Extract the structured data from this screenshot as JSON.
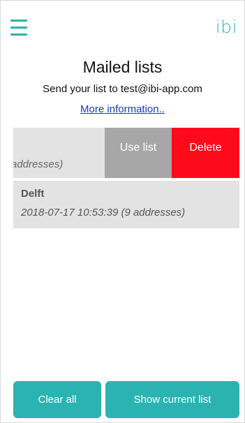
{
  "colors": {
    "accent": "#2bb3b1",
    "link": "#1b37c8",
    "use_list_bg": "#a7a7a7",
    "delete_bg": "#ff0a1a",
    "row_bg": "#e3e3e3"
  },
  "header": {
    "menu_icon": "hamburger-menu-icon",
    "logo_text": "ibi"
  },
  "main": {
    "title": "Mailed lists",
    "subtitle": "Send your list to test@ibi-app.com",
    "more_info_link": "More information.."
  },
  "lists": [
    {
      "visible_text": "addresses)",
      "actions": {
        "use_label": "Use list",
        "delete_label": "Delete"
      }
    },
    {
      "name": "Delft",
      "meta": "2018-07-17 10:53:39 (9 addresses)"
    }
  ],
  "footer": {
    "clear_label": "Clear all",
    "show_label": "Show current list"
  }
}
